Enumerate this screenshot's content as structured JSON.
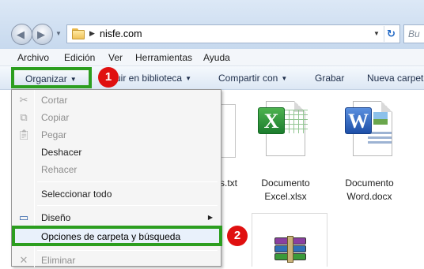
{
  "address_bar": {
    "path": "nisfe.com",
    "search_placeholder": "Bu"
  },
  "menubar": {
    "items": [
      "Archivo",
      "Edición",
      "Ver",
      "Herramientas",
      "Ayuda"
    ]
  },
  "commandbar": {
    "organize_label": "Organizar",
    "include_in_library": "uir en biblioteca",
    "share_with": "Compartir con",
    "burn": "Grabar",
    "new_folder": "Nueva carpet"
  },
  "steps": [
    "1",
    "2"
  ],
  "organize_menu": {
    "cut": "Cortar",
    "copy": "Copiar",
    "paste": "Pegar",
    "undo": "Deshacer",
    "redo": "Rehacer",
    "select_all": "Seleccionar todo",
    "layout": "Diseño",
    "folder_options": "Opciones de carpeta y búsqueda",
    "delete": "Eliminar"
  },
  "files": [
    {
      "name_line1": "",
      "name_line2": "tas.txt"
    },
    {
      "name_line1": "Documento",
      "name_line2": "Excel.xlsx"
    },
    {
      "name_line1": "Documento",
      "name_line2": "Word.docx"
    }
  ],
  "colors": {
    "highlight_border": "#2c9e1f",
    "step_badge": "#e01010"
  }
}
